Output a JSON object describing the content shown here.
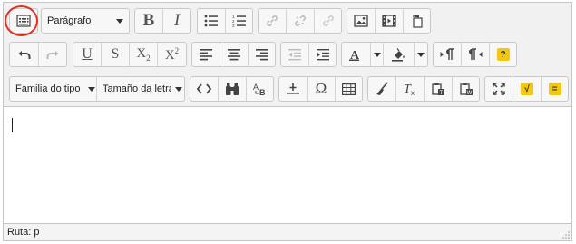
{
  "toolbar": {
    "paragraph_select": "Parágrafo",
    "font_family_select": "Familia do tipo",
    "font_size_select": "Tamaño da letra"
  },
  "status_bar": {
    "path_label": "Ruta:",
    "path_value": "p"
  },
  "colors": {
    "highlight": "#e0321e",
    "accent_yellow": "#f3c80f"
  }
}
